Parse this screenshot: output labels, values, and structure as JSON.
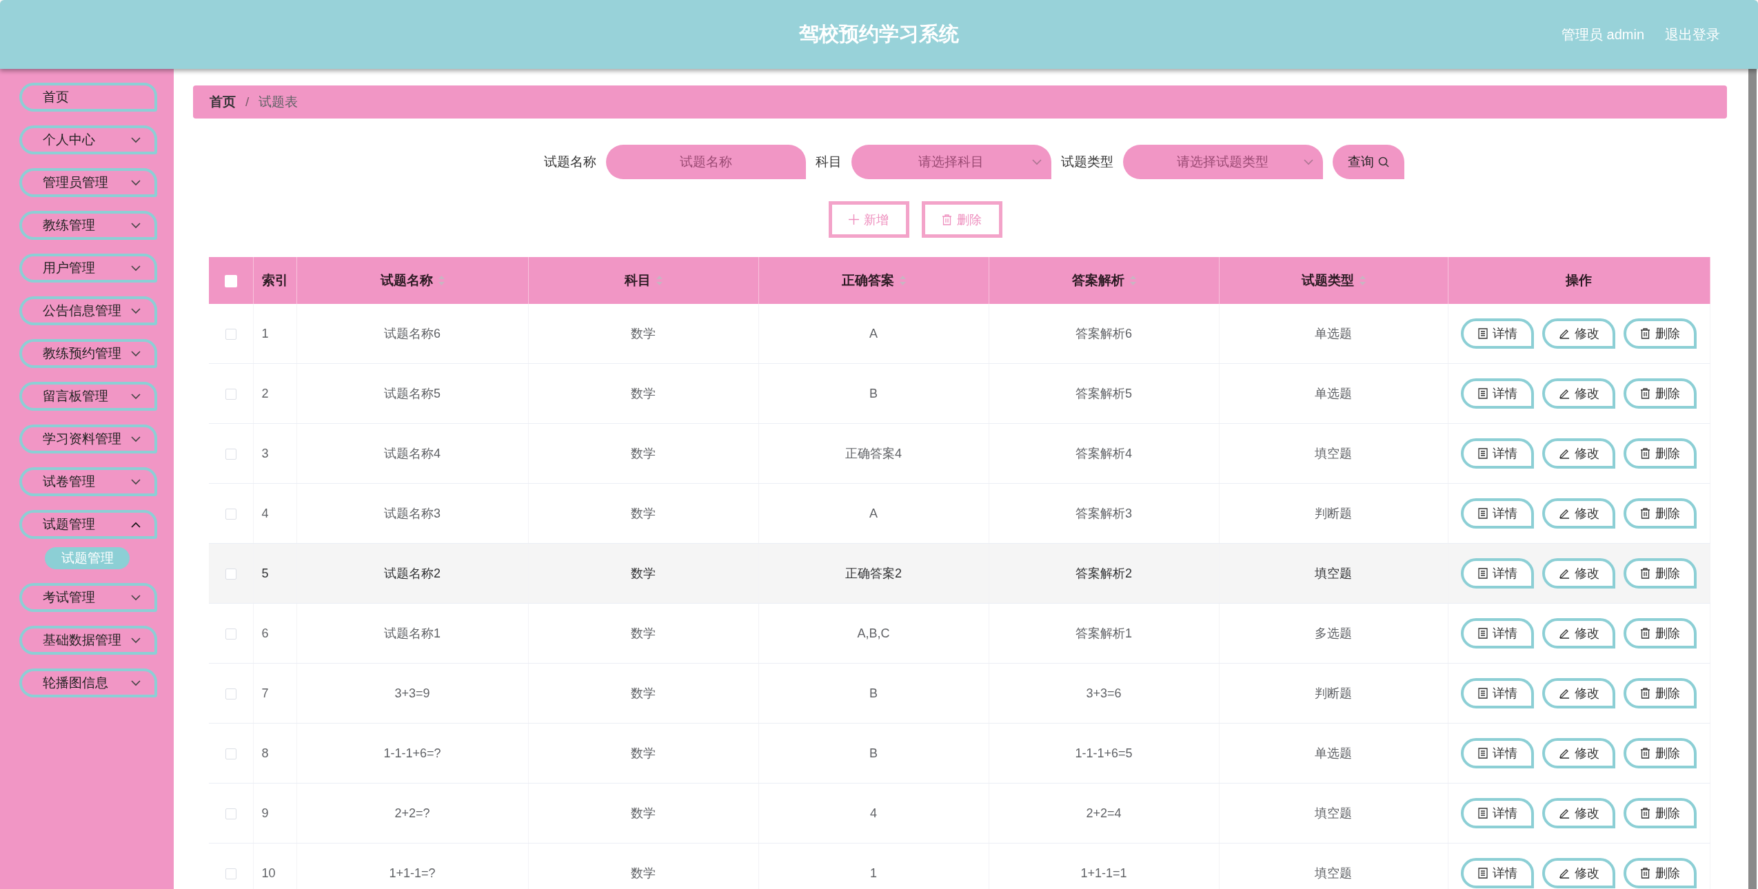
{
  "header": {
    "title": "驾校预约学习系统",
    "user": "管理员 admin",
    "logout": "退出登录"
  },
  "sidebar": {
    "items": [
      {
        "label": "首页",
        "kind": "link"
      },
      {
        "label": "个人中心",
        "kind": "menu",
        "expanded": false
      },
      {
        "label": "管理员管理",
        "kind": "menu",
        "expanded": false
      },
      {
        "label": "教练管理",
        "kind": "menu",
        "expanded": false
      },
      {
        "label": "用户管理",
        "kind": "menu",
        "expanded": false
      },
      {
        "label": "公告信息管理",
        "kind": "menu",
        "expanded": false
      },
      {
        "label": "教练预约管理",
        "kind": "menu",
        "expanded": false
      },
      {
        "label": "留言板管理",
        "kind": "menu",
        "expanded": false
      },
      {
        "label": "学习资料管理",
        "kind": "menu",
        "expanded": false
      },
      {
        "label": "试卷管理",
        "kind": "menu",
        "expanded": false
      },
      {
        "label": "试题管理",
        "kind": "menu",
        "expanded": true,
        "children": [
          {
            "label": "试题管理",
            "selected": true
          }
        ]
      },
      {
        "label": "考试管理",
        "kind": "menu",
        "expanded": false
      },
      {
        "label": "基础数据管理",
        "kind": "menu",
        "expanded": false
      },
      {
        "label": "轮播图信息",
        "kind": "menu",
        "expanded": false
      }
    ]
  },
  "breadcrumb": {
    "items": [
      "首页",
      "试题表"
    ],
    "separator": "/"
  },
  "search": {
    "fields": [
      {
        "label": "试题名称",
        "kind": "input",
        "placeholder": "试题名称"
      },
      {
        "label": "科目",
        "kind": "select",
        "placeholder": "请选择科目"
      },
      {
        "label": "试题类型",
        "kind": "select",
        "placeholder": "请选择试题类型"
      }
    ],
    "button": "查询"
  },
  "actions": [
    {
      "label": "新增",
      "kind": "add"
    },
    {
      "label": "删除",
      "kind": "delete"
    }
  ],
  "table": {
    "all_checked": false,
    "columns": [
      {
        "label": "索引",
        "sortable": false
      },
      {
        "label": "试题名称",
        "sortable": true
      },
      {
        "label": "科目",
        "sortable": true
      },
      {
        "label": "正确答案",
        "sortable": true
      },
      {
        "label": "答案解析",
        "sortable": true
      },
      {
        "label": "试题类型",
        "sortable": true
      },
      {
        "label": "操作",
        "sortable": false
      }
    ],
    "rows": [
      {
        "checked": false,
        "highlighted": false,
        "cells": [
          "1",
          "试题名称6",
          "数学",
          "A",
          "答案解析6",
          "单选题"
        ],
        "actions": [
          {
            "label": "详情",
            "kind": "detail"
          },
          {
            "label": "修改",
            "kind": "edit"
          },
          {
            "label": "删除",
            "kind": "delete"
          }
        ]
      },
      {
        "checked": false,
        "highlighted": false,
        "cells": [
          "2",
          "试题名称5",
          "数学",
          "B",
          "答案解析5",
          "单选题"
        ],
        "actions": [
          {
            "label": "详情",
            "kind": "detail"
          },
          {
            "label": "修改",
            "kind": "edit"
          },
          {
            "label": "删除",
            "kind": "delete"
          }
        ]
      },
      {
        "checked": false,
        "highlighted": false,
        "cells": [
          "3",
          "试题名称4",
          "数学",
          "正确答案4",
          "答案解析4",
          "填空题"
        ],
        "actions": [
          {
            "label": "详情",
            "kind": "detail"
          },
          {
            "label": "修改",
            "kind": "edit"
          },
          {
            "label": "删除",
            "kind": "delete"
          }
        ]
      },
      {
        "checked": false,
        "highlighted": false,
        "cells": [
          "4",
          "试题名称3",
          "数学",
          "A",
          "答案解析3",
          "判断题"
        ],
        "actions": [
          {
            "label": "详情",
            "kind": "detail"
          },
          {
            "label": "修改",
            "kind": "edit"
          },
          {
            "label": "删除",
            "kind": "delete"
          }
        ]
      },
      {
        "checked": false,
        "highlighted": true,
        "cells": [
          "5",
          "试题名称2",
          "数学",
          "正确答案2",
          "答案解析2",
          "填空题"
        ],
        "actions": [
          {
            "label": "详情",
            "kind": "detail"
          },
          {
            "label": "修改",
            "kind": "edit"
          },
          {
            "label": "删除",
            "kind": "delete"
          }
        ]
      },
      {
        "checked": false,
        "highlighted": false,
        "cells": [
          "6",
          "试题名称1",
          "数学",
          "A,B,C",
          "答案解析1",
          "多选题"
        ],
        "actions": [
          {
            "label": "详情",
            "kind": "detail"
          },
          {
            "label": "修改",
            "kind": "edit"
          },
          {
            "label": "删除",
            "kind": "delete"
          }
        ]
      },
      {
        "checked": false,
        "highlighted": false,
        "cells": [
          "7",
          "3+3=9",
          "数学",
          "B",
          "3+3=6",
          "判断题"
        ],
        "actions": [
          {
            "label": "详情",
            "kind": "detail"
          },
          {
            "label": "修改",
            "kind": "edit"
          },
          {
            "label": "删除",
            "kind": "delete"
          }
        ]
      },
      {
        "checked": false,
        "highlighted": false,
        "cells": [
          "8",
          "1-1-1+6=?",
          "数学",
          "B",
          "1-1-1+6=5",
          "单选题"
        ],
        "actions": [
          {
            "label": "详情",
            "kind": "detail"
          },
          {
            "label": "修改",
            "kind": "edit"
          },
          {
            "label": "删除",
            "kind": "delete"
          }
        ]
      },
      {
        "checked": false,
        "highlighted": false,
        "cells": [
          "9",
          "2+2=?",
          "数学",
          "4",
          "2+2=4",
          "填空题"
        ],
        "actions": [
          {
            "label": "详情",
            "kind": "detail"
          },
          {
            "label": "修改",
            "kind": "edit"
          },
          {
            "label": "删除",
            "kind": "delete"
          }
        ]
      },
      {
        "checked": false,
        "highlighted": false,
        "cells": [
          "10",
          "1+1-1=?",
          "数学",
          "1",
          "1+1-1=1",
          "填空题"
        ],
        "actions": [
          {
            "label": "详情",
            "kind": "detail"
          },
          {
            "label": "修改",
            "kind": "edit"
          },
          {
            "label": "删除",
            "kind": "delete"
          }
        ]
      }
    ]
  }
}
